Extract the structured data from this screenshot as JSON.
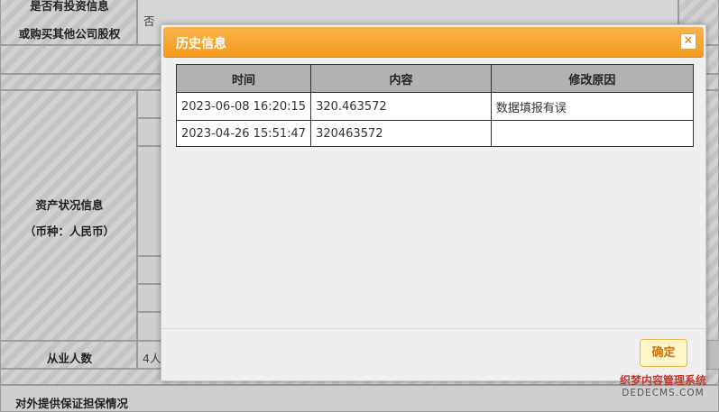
{
  "background_form": {
    "investment_label_line1": "是否有投资信息",
    "investment_label_line2": "或购买其他公司股权",
    "investment_value": "否",
    "assets_label_line1": "资产状况信息",
    "assets_label_line2": "（币种：人民币）",
    "employees_label": "从业人数",
    "employees_value": "4人",
    "guarantee_label": "对外提供保证担保情况"
  },
  "dialog": {
    "title": "历史信息",
    "close_symbol": "✕",
    "columns": [
      "时间",
      "内容",
      "修改原因"
    ],
    "rows": [
      [
        "2023-06-08 16:20:15",
        "320.463572",
        "数据填报有误"
      ],
      [
        "2023-04-26 15:51:47",
        "320463572",
        ""
      ]
    ],
    "confirm_label": "确定"
  },
  "watermark": {
    "line1": "织梦内容管理系统",
    "line2": "DEDECMS.COM"
  },
  "colors": {
    "header_orange": "#f39a1e",
    "table_header_gray": "#b2b2b2",
    "confirm_bg": "#fff6c8"
  }
}
